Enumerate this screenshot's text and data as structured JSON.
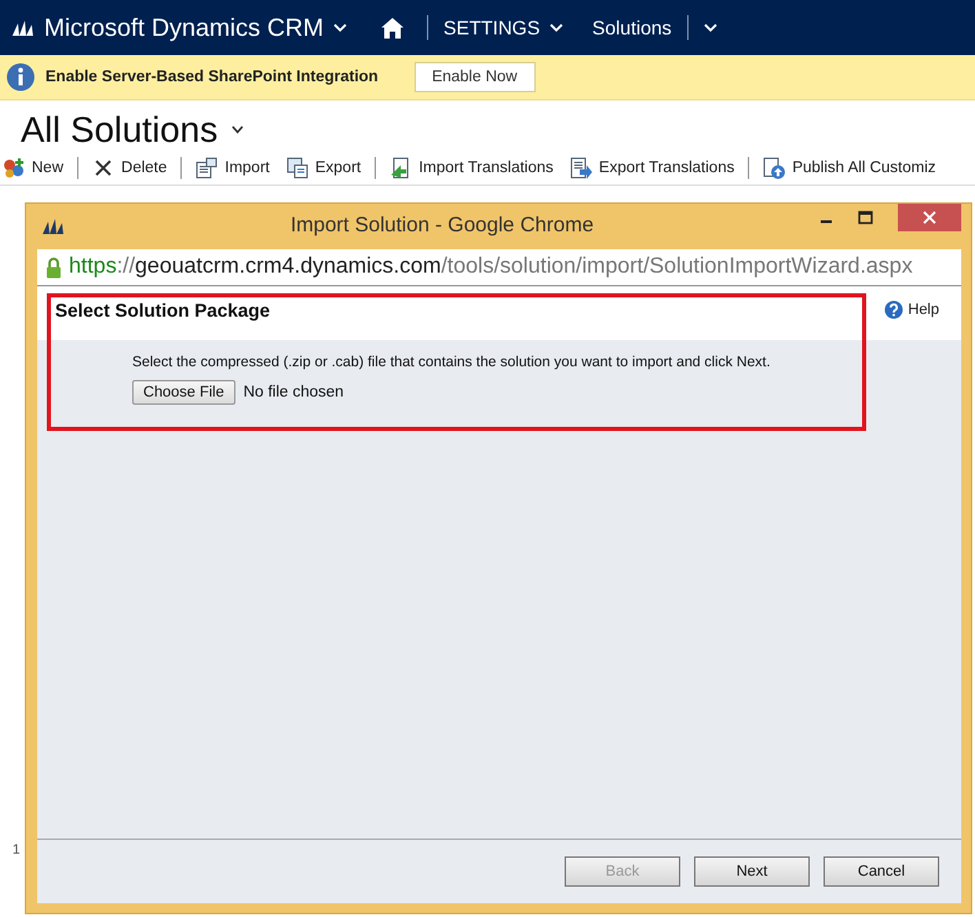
{
  "nav": {
    "app": "Microsoft Dynamics CRM",
    "area": "SETTINGS",
    "page": "Solutions"
  },
  "notification": {
    "message": "Enable Server-Based SharePoint Integration",
    "button": "Enable Now"
  },
  "view_title": "All Solutions",
  "toolbar": [
    {
      "label": "New",
      "kind": "new"
    },
    {
      "label": "Delete",
      "kind": "delete"
    },
    {
      "label": "Import",
      "kind": "import"
    },
    {
      "label": "Export",
      "kind": "export"
    },
    {
      "label": "Import Translations",
      "kind": "importtr"
    },
    {
      "label": "Export Translations",
      "kind": "exporttr"
    },
    {
      "label": "Publish All Customiz",
      "kind": "publish"
    }
  ],
  "grid": {
    "row_number": "1"
  },
  "dialog": {
    "title": "Import Solution - Google Chrome",
    "url": {
      "secure": true,
      "scheme": "https",
      "separator": "://",
      "host": "geouatcrm.crm4.dynamics.com",
      "path": "/tools/solution/import/SolutionImportWizard.aspx"
    },
    "heading": "Select Solution Package",
    "help": "Help",
    "instruction": "Select the compressed (.zip or .cab) file that contains the solution you want to import and click Next.",
    "file_button": "Choose File",
    "file_status": "No file chosen",
    "buttons": [
      {
        "label": "Back",
        "disabled": true
      },
      {
        "label": "Next",
        "disabled": false
      },
      {
        "label": "Cancel",
        "disabled": false
      }
    ]
  }
}
